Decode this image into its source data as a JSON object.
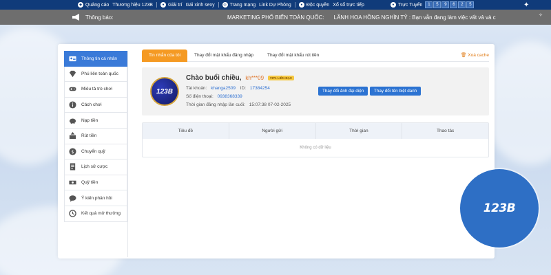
{
  "topbar": {
    "items": [
      {
        "label": "Quảng cáo",
        "icon": "megaphone-icon"
      },
      {
        "label": "Thương hiệu 123B",
        "icon": ""
      },
      {
        "label": "Giải trí",
        "icon": "gamepad-icon"
      },
      {
        "label": "Gái xinh sexy",
        "icon": ""
      },
      {
        "label": "Trang mạng",
        "icon": "globe-icon"
      },
      {
        "label": "Link Dự Phòng",
        "icon": ""
      },
      {
        "label": "Độc quyền",
        "icon": "user-icon"
      },
      {
        "label": "Xổ số trực tiếp",
        "icon": ""
      },
      {
        "label": "Trực Tuyến",
        "icon": "user-icon"
      }
    ],
    "online_digits": [
      "1",
      "5",
      "9",
      "6",
      "2",
      "5"
    ]
  },
  "notice": {
    "label": "Thông báo:",
    "messages": [
      "MARKETING PHỔ BIẾN TOÀN QUỐC:",
      "LÃNH HOA HỒNG NGHÌN TỶ : Bạn vẫn đang làm việc vất vả và c"
    ]
  },
  "sidebar": {
    "items": [
      {
        "label": "Thông tin cá nhân",
        "icon": "user-card-icon",
        "active": true
      },
      {
        "label": "Phú liên toàn quốc",
        "icon": "diamond-icon",
        "active": false
      },
      {
        "label": "Miêu tả trò chơi",
        "icon": "gamepad-icon",
        "active": false
      },
      {
        "label": "Cách chơi",
        "icon": "info-icon",
        "active": false
      },
      {
        "label": "Nạp tiền",
        "icon": "piggy-bank-icon",
        "active": false
      },
      {
        "label": "Rút tiền",
        "icon": "withdraw-icon",
        "active": false
      },
      {
        "label": "Chuyển quỹ",
        "icon": "transfer-icon",
        "active": false
      },
      {
        "label": "Lịch sử cược",
        "icon": "document-icon",
        "active": false
      },
      {
        "label": "Quỹ tiền",
        "icon": "money-icon",
        "active": false
      },
      {
        "label": "Ý kiến phản hồi",
        "icon": "chat-icon",
        "active": false
      },
      {
        "label": "Kết quả mở thưởng",
        "icon": "history-icon",
        "active": false
      }
    ]
  },
  "tabs": {
    "items": [
      "Tin nhắn của tôi",
      "Thay đổi mật khẩu đăng nhập",
      "Thay đổi mật khẩu rút tiền"
    ],
    "clear_cache": "Xoá cache"
  },
  "profile": {
    "greeting": "Chào buổi chiều,",
    "username": "kh***09",
    "vip_badge": "VIP1 LIÊN BẠC",
    "account_label": "Tài khoản:",
    "account_value": "khanga2509",
    "id_label": "ID:",
    "id_value": "17384254",
    "phone_label": "Số điện thoại:",
    "phone_value": "0938368339",
    "login_label": "Thời gian đăng nhập lần cuối:",
    "login_value": "15:07:38 07-02-2025",
    "avatar_text": "123B",
    "btn_avatar": "Thay đổi ảnh đại diện",
    "btn_nickname": "Thay đổi tên biệt danh"
  },
  "table": {
    "headers": [
      "Tiêu đề",
      "Người gửi",
      "Thời gian",
      "Thao tác"
    ],
    "empty": "Không có dữ liệu"
  },
  "brand": {
    "logo_text": "123B"
  }
}
